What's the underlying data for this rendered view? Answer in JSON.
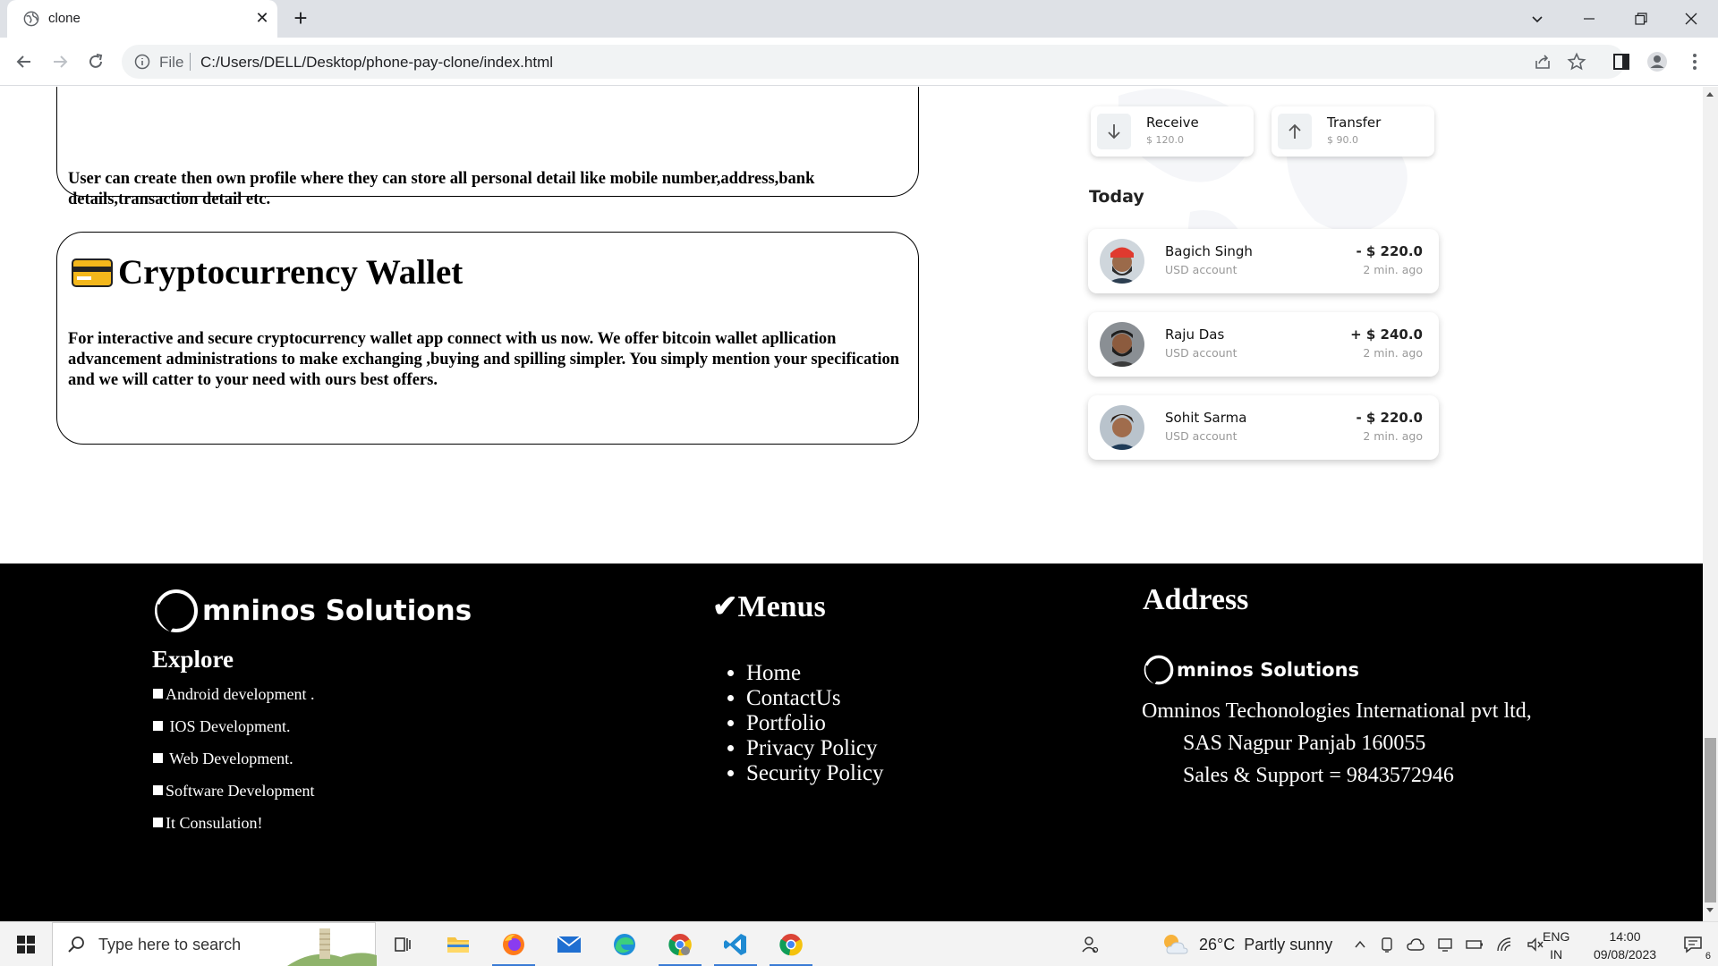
{
  "browser": {
    "tab_title": "clone",
    "url_scheme": "File",
    "url": "C:/Users/DELL/Desktop/phone-pay-clone/index.html"
  },
  "cards": {
    "profile_text": "User can create then own profile where they can store all personal detail like mobile number,address,bank details,transaction detail etc.",
    "wallet_title": "Cryptocurrency Wallet",
    "wallet_text": "For interactive and secure cryptocurrency wallet app connect with us now. We offer bitcoin wallet apllication advancement administrations to make exchanging ,buying and spilling simpler. You simply mention your specification and we will catter to your need with ours best offers."
  },
  "phone": {
    "receive_label": "Receive",
    "receive_value": "$ 120.0",
    "transfer_label": "Transfer",
    "transfer_value": "$ 90.0",
    "today_label": "Today",
    "transactions": [
      {
        "name": "Bagich Singh",
        "account": "USD account",
        "amount": "- $ 220.0",
        "time": "2 min. ago"
      },
      {
        "name": "Raju Das",
        "account": "USD account",
        "amount": "+ $ 240.0",
        "time": "2 min. ago"
      },
      {
        "name": "Sohit Sarma",
        "account": "USD account",
        "amount": "- $ 220.0",
        "time": "2 min. ago"
      }
    ]
  },
  "footer": {
    "brand": "mninos Solutions",
    "explore_title": "Explore",
    "explore_items": [
      "Android development .",
      " IOS Development.",
      " Web Development.",
      "Software Development",
      "It Consulation!"
    ],
    "menus_title": "✔Menus",
    "menu_items": [
      "Home",
      "ContactUs",
      "Portfolio",
      "Privacy Policy",
      "Security Policy"
    ],
    "address_title": "Address",
    "address_brand": "mninos Solutions",
    "address_line1": "Omninos Techonologies International pvt ltd,",
    "address_line2": "SAS Nagpur Panjab 160055",
    "address_line3": "Sales & Support = 9843572946"
  },
  "taskbar": {
    "search_placeholder": "Type here to search",
    "weather": "26°C  Partly sunny",
    "lang_top": "ENG",
    "lang_bottom": "IN",
    "time": "14:00",
    "date": "09/08/2023",
    "notification_count": "6"
  }
}
